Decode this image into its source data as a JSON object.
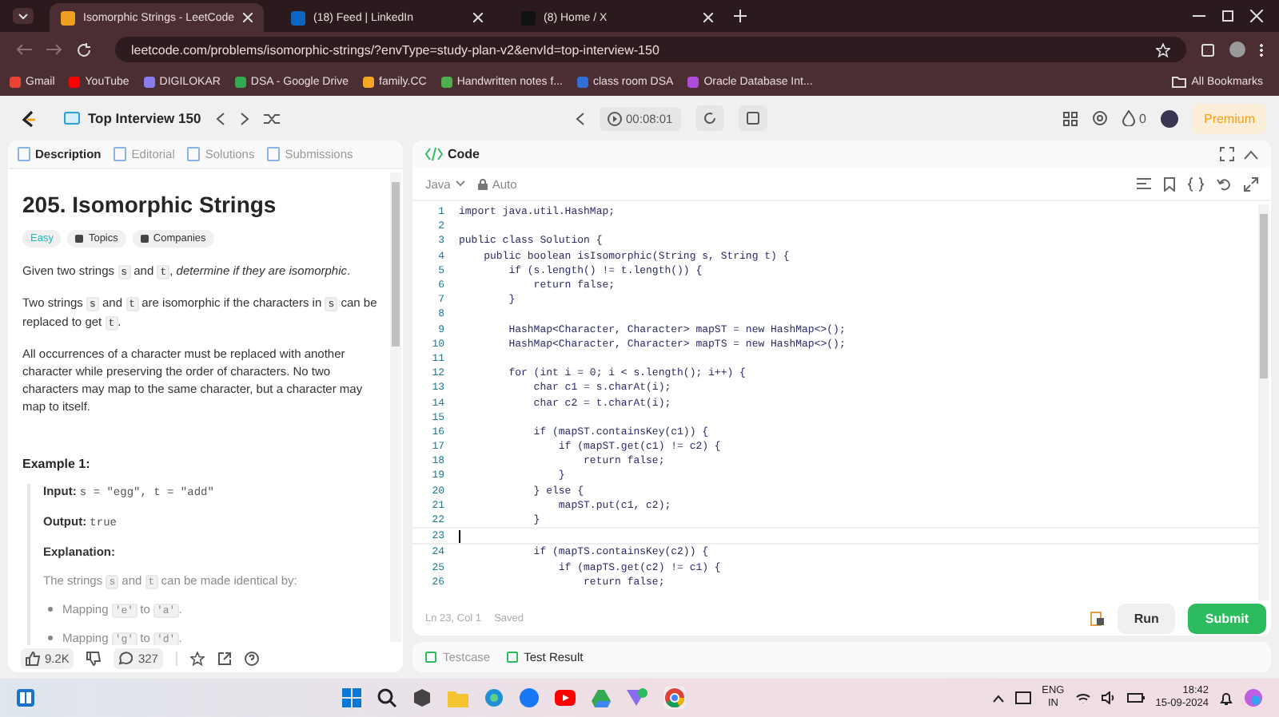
{
  "browser": {
    "tabs": [
      {
        "title": "Isomorphic Strings - LeetCode",
        "selected": true,
        "color": "#f0a020"
      },
      {
        "title": "(18) Feed | LinkedIn",
        "selected": false,
        "color": "#0a66c2"
      },
      {
        "title": "(8) Home / X",
        "selected": false,
        "color": "#111111"
      }
    ],
    "url": "leetcode.com/problems/isomorphic-strings/?envType=study-plan-v2&envId=top-interview-150",
    "bookmarks": [
      {
        "label": "Gmail",
        "color": "#ea4335"
      },
      {
        "label": "YouTube",
        "color": "#ff0000"
      },
      {
        "label": "DIGILOKAR",
        "color": "#8b7cf0"
      },
      {
        "label": "DSA - Google Drive",
        "color": "#34a853"
      },
      {
        "label": "family.CC",
        "color": "#f5a623"
      },
      {
        "label": "Handwritten notes f...",
        "color": "#4caf50"
      },
      {
        "label": "class room DSA",
        "color": "#2f6fd6"
      },
      {
        "label": "Oracle Database Int...",
        "color": "#b04ad8"
      }
    ],
    "all_bookmarks": "All Bookmarks"
  },
  "nav": {
    "study_plan": "Top Interview 150",
    "timer": "00:08:01",
    "streak": "0",
    "premium": "Premium"
  },
  "problem": {
    "tabs": [
      {
        "label": "Description",
        "selected": true
      },
      {
        "label": "Editorial",
        "selected": false
      },
      {
        "label": "Solutions",
        "selected": false
      },
      {
        "label": "Submissions",
        "selected": false
      }
    ],
    "title": "205. Isomorphic Strings",
    "difficulty": "Easy",
    "tags": [
      "Topics",
      "Companies"
    ],
    "paragraphs": [
      [
        {
          "kind": "text",
          "text": "Given two strings "
        },
        {
          "kind": "code",
          "text": "s"
        },
        {
          "kind": "text",
          "text": " and "
        },
        {
          "kind": "code",
          "text": "t"
        },
        {
          "kind": "text",
          "text": ", "
        },
        {
          "kind": "italic",
          "text": "determine if they are isomorphic"
        },
        {
          "kind": "text",
          "text": "."
        }
      ],
      [
        {
          "kind": "text",
          "text": "Two strings "
        },
        {
          "kind": "code",
          "text": "s"
        },
        {
          "kind": "text",
          "text": " and "
        },
        {
          "kind": "code",
          "text": "t"
        },
        {
          "kind": "text",
          "text": " are isomorphic if the characters in "
        },
        {
          "kind": "code",
          "text": "s"
        },
        {
          "kind": "text",
          "text": " can be replaced to get "
        },
        {
          "kind": "code",
          "text": "t"
        },
        {
          "kind": "text",
          "text": "."
        }
      ],
      [
        {
          "kind": "text",
          "text": "All occurrences of a character must be replaced with another character while preserving the order of characters. No two characters may map to the same character, but a character may map to itself."
        }
      ]
    ],
    "example": {
      "heading": "Example 1:",
      "input_label": "Input:",
      "input": "s = \"egg\", t = \"add\"",
      "output_label": "Output:",
      "output": "true",
      "explanation_label": "Explanation:",
      "explanation": [
        {
          "kind": "text",
          "text": "The strings "
        },
        {
          "kind": "code",
          "text": "s"
        },
        {
          "kind": "text",
          "text": " and "
        },
        {
          "kind": "code",
          "text": "t"
        },
        {
          "kind": "text",
          "text": " can be made identical by:"
        }
      ],
      "bullets": [
        [
          {
            "kind": "text",
            "text": "Mapping "
          },
          {
            "kind": "code",
            "text": "'e'"
          },
          {
            "kind": "text",
            "text": " to "
          },
          {
            "kind": "code",
            "text": "'a'"
          },
          {
            "kind": "text",
            "text": "."
          }
        ],
        [
          {
            "kind": "text",
            "text": "Mapping "
          },
          {
            "kind": "code",
            "text": "'g'"
          },
          {
            "kind": "text",
            "text": " to "
          },
          {
            "kind": "code",
            "text": "'d'"
          },
          {
            "kind": "text",
            "text": "."
          }
        ]
      ]
    },
    "likes": "9.2K",
    "comments": "327"
  },
  "editor": {
    "title": "Code",
    "language": "Java",
    "mode": "Auto",
    "lines": [
      {
        "n": "1",
        "code": "import java.util.HashMap;",
        "current": false
      },
      {
        "n": "2",
        "current": false
      },
      {
        "n": "3",
        "code": "public class Solution {",
        "current": false
      },
      {
        "n": "4",
        "code": "    public boolean isIsomorphic(String s, String t) {",
        "current": false
      },
      {
        "n": "5",
        "code": "        if (s.length() != t.length()) {",
        "current": false
      },
      {
        "n": "6",
        "code": "            return false;",
        "current": false
      },
      {
        "n": "7",
        "code": "        }",
        "current": false
      },
      {
        "n": "8",
        "current": false
      },
      {
        "n": "9",
        "code": "        HashMap<Character, Character> mapST = new HashMap<>();",
        "current": false
      },
      {
        "n": "10",
        "code": "        HashMap<Character, Character> mapTS = new HashMap<>();",
        "current": false
      },
      {
        "n": "11",
        "current": false
      },
      {
        "n": "12",
        "code": "        for (int i = 0; i < s.length(); i++) {",
        "current": false
      },
      {
        "n": "13",
        "code": "            char c1 = s.charAt(i);",
        "current": false
      },
      {
        "n": "14",
        "code": "            char c2 = t.charAt(i);",
        "current": false
      },
      {
        "n": "15",
        "current": false
      },
      {
        "n": "16",
        "code": "            if (mapST.containsKey(c1)) {",
        "current": false
      },
      {
        "n": "17",
        "code": "                if (mapST.get(c1) != c2) {",
        "current": false
      },
      {
        "n": "18",
        "code": "                    return false;",
        "current": false
      },
      {
        "n": "19",
        "code": "                }",
        "current": false
      },
      {
        "n": "20",
        "code": "            } else {",
        "current": false
      },
      {
        "n": "21",
        "code": "                mapST.put(c1, c2);",
        "current": false
      },
      {
        "n": "22",
        "code": "            }",
        "current": false
      },
      {
        "n": "23",
        "current": true
      },
      {
        "n": "24",
        "code": "            if (mapTS.containsKey(c2)) {",
        "current": false
      },
      {
        "n": "25",
        "code": "                if (mapTS.get(c2) != c1) {",
        "current": false
      },
      {
        "n": "26",
        "code": "                    return false;",
        "current": false
      }
    ],
    "cursor": "Ln 23, Col 1",
    "saved": "Saved",
    "run": "Run",
    "submit": "Submit"
  },
  "result_tabs": [
    {
      "label": "Testcase",
      "selected": false
    },
    {
      "label": "Test Result",
      "selected": true
    }
  ],
  "taskbar": {
    "lang": "ENG",
    "region": "IN",
    "time": "18:42",
    "date": "15-09-2024"
  }
}
